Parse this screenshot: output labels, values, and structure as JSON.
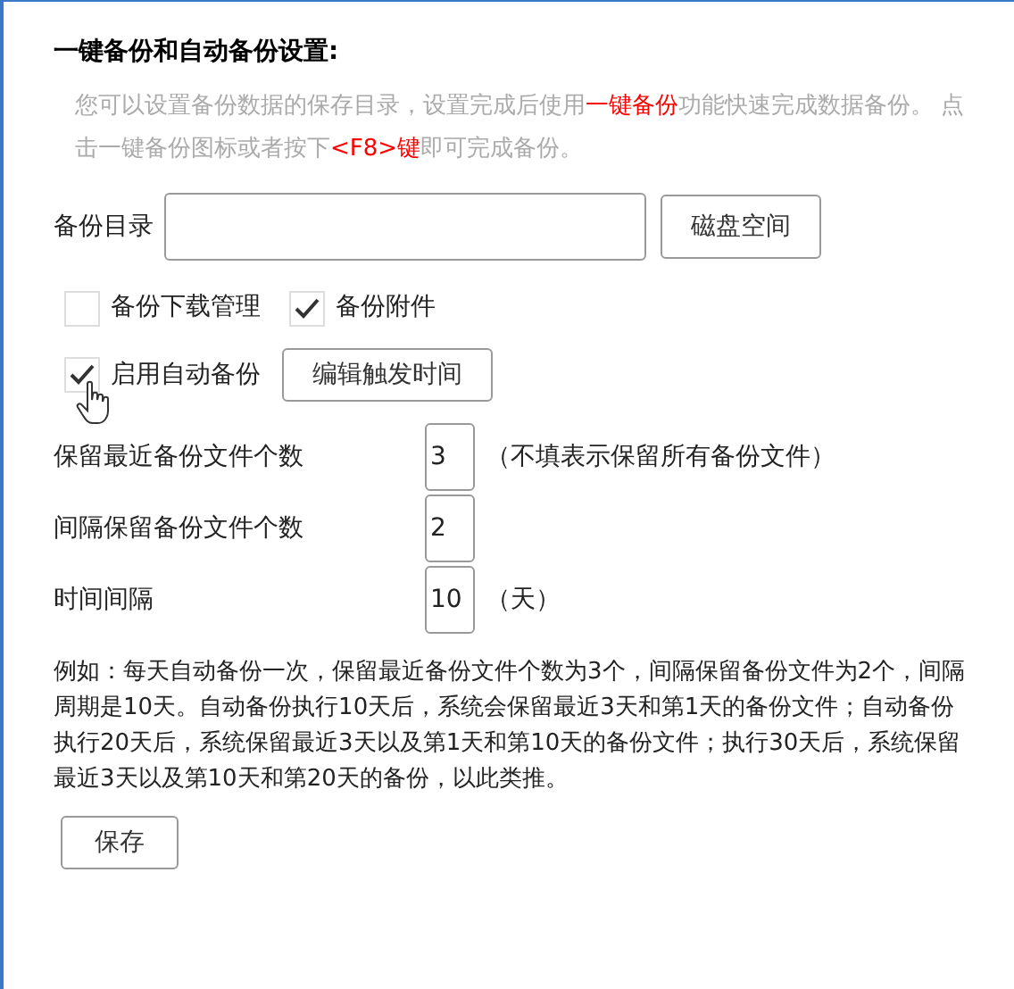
{
  "title": "一键备份和自动备份设置:",
  "description": [
    {
      "text": "您可以设置备份数据的保存目录，设置完成后使用",
      "highlight": false
    },
    {
      "text": "一键备份",
      "highlight": true
    },
    {
      "text": "功能快速完成数据备份。 点击一键备份图标或者按下",
      "highlight": false
    },
    {
      "text": "<F8>键",
      "highlight": true
    },
    {
      "text": "即可完成备份。",
      "highlight": false
    }
  ],
  "backup_dir": {
    "label": "备份目录",
    "button": "磁盘空间"
  },
  "options": [
    {
      "label": "备份下载管理",
      "checked": false
    },
    {
      "label": "备份附件",
      "checked": true
    }
  ],
  "auto_backup": {
    "label": "启用自动备份",
    "checked": true,
    "button": "编辑触发时间"
  },
  "fields": [
    {
      "label": "保留最近备份文件个数",
      "value": "3",
      "note": "（不填表示保留所有备份文件）"
    },
    {
      "label": "间隔保留备份文件个数",
      "value": "2"
    },
    {
      "label": "时间间隔",
      "value": "10",
      "note": "（天）"
    }
  ],
  "example": "例如：每天自动备份一次，保留最近备份文件个数为3个，间隔保留备份文件为2个，间隔周期是10天。自动备份执行10天后，系统会保留最近3天和第1天的备份文件；自动备份执行20天后，系统保留最近3天以及第1天和第10天的备份文件；执行30天后，系统保留最近3天以及第10天和第20天的备份，以此类推。",
  "save_button": "保存"
}
